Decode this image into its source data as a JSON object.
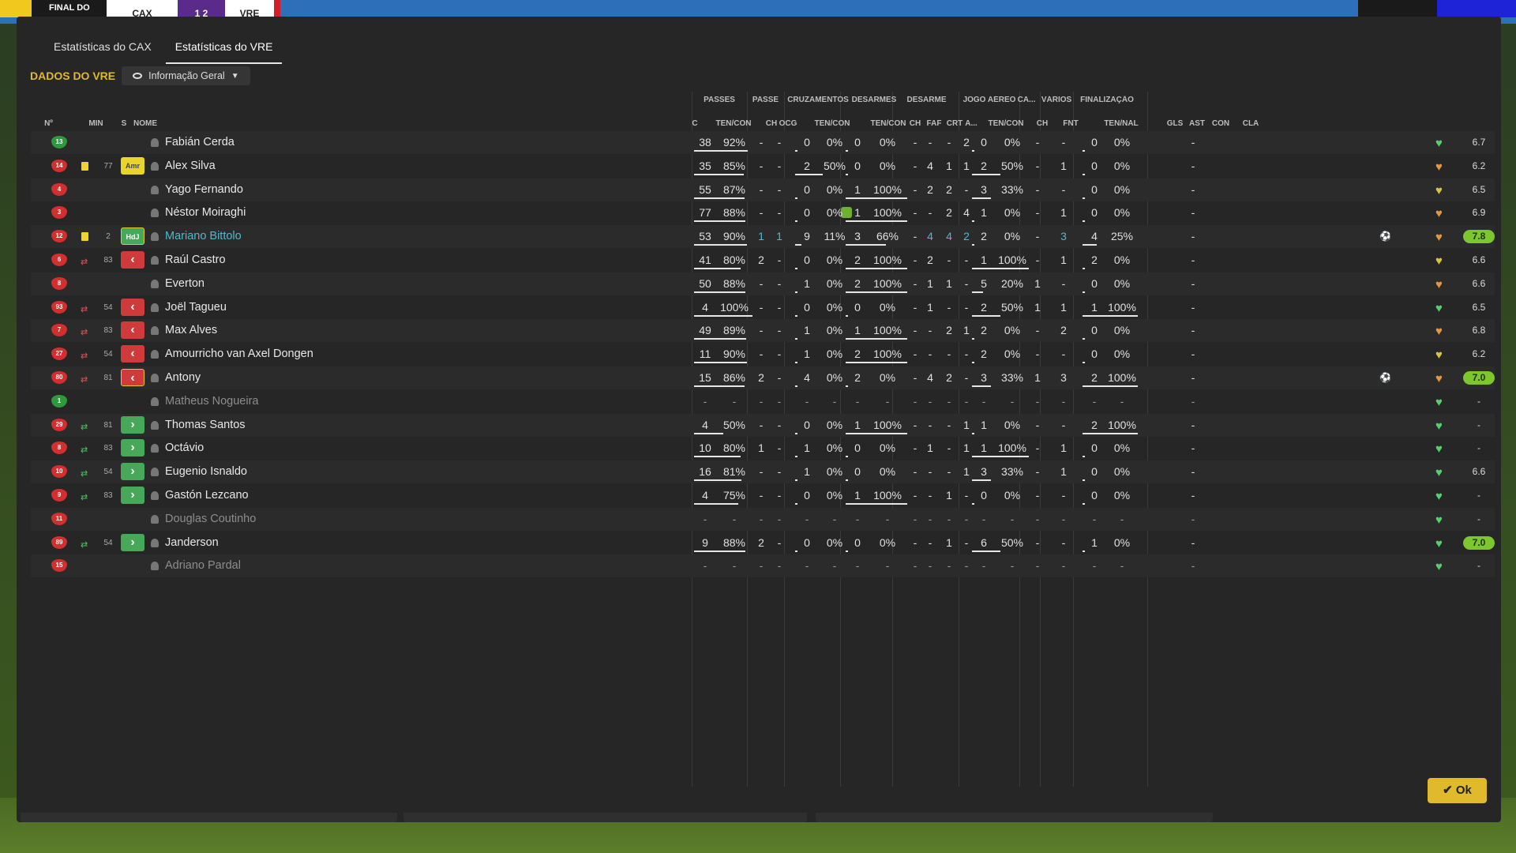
{
  "scoreboard": {
    "label": "FINAL DO",
    "home": "CAX",
    "score": "1 2",
    "away": "VRE"
  },
  "tabs": [
    {
      "label": "Estatísticas do CAX"
    },
    {
      "label": "Estatísticas do VRE"
    }
  ],
  "section_title": "DADOS DO VRE",
  "view_dropdown": "Informação Geral",
  "ok_label": "Ok",
  "group_headers": [
    "PASSES",
    "PASSE",
    "CRUZAMENTOS",
    "DESARMES",
    "DESARME",
    "JOGO AÉREO",
    "CA...",
    "VÁRIOS",
    "FINALIZAÇÃO"
  ],
  "column_headers": [
    "Nº",
    "MIN",
    "S",
    "NOME",
    "C",
    "TEN/CON",
    "CH",
    "OCG",
    "TEN/CON",
    "TEN/CON",
    "CH",
    "FAF",
    "CRT",
    "A...",
    "TEN/CON",
    "CH",
    "FNT",
    "TEN/NAL",
    "GLS",
    "AST",
    "CON",
    "CLA"
  ],
  "colors": {
    "accent": "#e1b92c",
    "highlight": "#4fb9d0",
    "best_rating": "#7cc72e"
  },
  "players": [
    {
      "no": "13",
      "kit": "g",
      "card": "",
      "minute": "",
      "status": "",
      "name": "Fabián Cerda",
      "style": "",
      "med": false,
      "pass_a": "38",
      "pass_b": "92%",
      "pch": "-",
      "ocg": "-",
      "cr_a": "0",
      "cr_b": "0%",
      "de_a": "0",
      "de_b": "0%",
      "dch": "-",
      "faf": "-",
      "crt": "-",
      "da": "2",
      "ja_a": "0",
      "ja_b": "0%",
      "cach": "-",
      "fnt": "-",
      "fi_a": "0",
      "fi_b": "0%",
      "gls": "",
      "ast": "-",
      "con": "green",
      "cla": "6.7",
      "best": false
    },
    {
      "no": "14",
      "kit": "r",
      "card": "y",
      "minute": "77",
      "status": "amr",
      "name": "Alex Silva",
      "style": "",
      "med": false,
      "pass_a": "35",
      "pass_b": "85%",
      "pch": "-",
      "ocg": "-",
      "cr_a": "2",
      "cr_b": "50%",
      "de_a": "0",
      "de_b": "0%",
      "dch": "-",
      "faf": "4",
      "crt": "1",
      "da": "1",
      "ja_a": "2",
      "ja_b": "50%",
      "cach": "-",
      "fnt": "1",
      "fi_a": "0",
      "fi_b": "0%",
      "gls": "",
      "ast": "-",
      "con": "orange",
      "cla": "6.2",
      "best": false
    },
    {
      "no": "4",
      "kit": "r",
      "card": "",
      "minute": "",
      "status": "",
      "name": "Yago Fernando",
      "style": "",
      "med": false,
      "pass_a": "55",
      "pass_b": "87%",
      "pch": "-",
      "ocg": "-",
      "cr_a": "0",
      "cr_b": "0%",
      "de_a": "1",
      "de_b": "100%",
      "dch": "-",
      "faf": "2",
      "crt": "2",
      "da": "-",
      "ja_a": "3",
      "ja_b": "33%",
      "cach": "-",
      "fnt": "-",
      "fi_a": "0",
      "fi_b": "0%",
      "gls": "",
      "ast": "-",
      "con": "yellow",
      "cla": "6.5",
      "best": false
    },
    {
      "no": "3",
      "kit": "r",
      "card": "",
      "minute": "",
      "status": "",
      "name": "Néstor Moiraghi",
      "style": "",
      "med": true,
      "pass_a": "77",
      "pass_b": "88%",
      "pch": "-",
      "ocg": "-",
      "cr_a": "0",
      "cr_b": "0%",
      "de_a": "1",
      "de_b": "100%",
      "dch": "-",
      "faf": "-",
      "crt": "2",
      "da": "4",
      "ja_a": "1",
      "ja_b": "0%",
      "cach": "-",
      "fnt": "1",
      "fi_a": "0",
      "fi_b": "0%",
      "gls": "",
      "ast": "-",
      "con": "orange",
      "cla": "6.9",
      "best": false
    },
    {
      "no": "12",
      "kit": "r",
      "card": "y",
      "minute": "2",
      "status": "hdj",
      "name": "Mariano Bittolo",
      "style": "hl",
      "med": false,
      "pass_a": "53",
      "pass_b": "90%",
      "pch": "1",
      "ocg": "1",
      "cr_a": "9",
      "cr_b": "11%",
      "de_a": "3",
      "de_b": "66%",
      "dch": "-",
      "faf": "4",
      "crt": "4",
      "da": "2",
      "ja_a": "2",
      "ja_b": "0%",
      "cach": "-",
      "fnt": "3",
      "fi_a": "4",
      "fi_b": "25%",
      "gls": "⚽",
      "ast": "-",
      "con": "orange",
      "cla": "7.8",
      "best": true
    },
    {
      "no": "6",
      "kit": "r",
      "card": "",
      "minute": "83",
      "status": "out",
      "name": "Raúl Castro",
      "style": "",
      "med": false,
      "pass_a": "41",
      "pass_b": "80%",
      "pch": "2",
      "ocg": "-",
      "cr_a": "0",
      "cr_b": "0%",
      "de_a": "2",
      "de_b": "100%",
      "dch": "-",
      "faf": "2",
      "crt": "-",
      "da": "-",
      "ja_a": "1",
      "ja_b": "100%",
      "cach": "-",
      "fnt": "1",
      "fi_a": "2",
      "fi_b": "0%",
      "gls": "",
      "ast": "-",
      "con": "yellow",
      "cla": "6.6",
      "best": false
    },
    {
      "no": "8",
      "kit": "r",
      "card": "",
      "minute": "",
      "status": "",
      "name": "Everton",
      "style": "",
      "med": false,
      "pass_a": "50",
      "pass_b": "88%",
      "pch": "-",
      "ocg": "-",
      "cr_a": "1",
      "cr_b": "0%",
      "de_a": "2",
      "de_b": "100%",
      "dch": "-",
      "faf": "1",
      "crt": "1",
      "da": "-",
      "ja_a": "5",
      "ja_b": "20%",
      "cach": "1",
      "fnt": "-",
      "fi_a": "0",
      "fi_b": "0%",
      "gls": "",
      "ast": "-",
      "con": "orange",
      "cla": "6.6",
      "best": false
    },
    {
      "no": "93",
      "kit": "r",
      "card": "",
      "minute": "54",
      "status": "out",
      "name": "Joël Tagueu",
      "style": "",
      "med": false,
      "pass_a": "4",
      "pass_b": "100%",
      "pch": "-",
      "ocg": "-",
      "cr_a": "0",
      "cr_b": "0%",
      "de_a": "0",
      "de_b": "0%",
      "dch": "-",
      "faf": "1",
      "crt": "-",
      "da": "-",
      "ja_a": "2",
      "ja_b": "50%",
      "cach": "1",
      "fnt": "1",
      "fi_a": "1",
      "fi_b": "100%",
      "gls": "",
      "ast": "-",
      "con": "green",
      "cla": "6.5",
      "best": false
    },
    {
      "no": "7",
      "kit": "r",
      "card": "",
      "minute": "83",
      "status": "out",
      "name": "Max Alves",
      "style": "",
      "med": false,
      "pass_a": "49",
      "pass_b": "89%",
      "pch": "-",
      "ocg": "-",
      "cr_a": "1",
      "cr_b": "0%",
      "de_a": "1",
      "de_b": "100%",
      "dch": "-",
      "faf": "-",
      "crt": "2",
      "da": "1",
      "ja_a": "2",
      "ja_b": "0%",
      "cach": "-",
      "fnt": "2",
      "fi_a": "0",
      "fi_b": "0%",
      "gls": "",
      "ast": "-",
      "con": "orange",
      "cla": "6.8",
      "best": false
    },
    {
      "no": "27",
      "kit": "r",
      "card": "",
      "minute": "54",
      "status": "out",
      "name": "Amourricho van Axel Dongen",
      "style": "",
      "med": false,
      "pass_a": "11",
      "pass_b": "90%",
      "pch": "-",
      "ocg": "-",
      "cr_a": "1",
      "cr_b": "0%",
      "de_a": "2",
      "de_b": "100%",
      "dch": "-",
      "faf": "-",
      "crt": "-",
      "da": "-",
      "ja_a": "2",
      "ja_b": "0%",
      "cach": "-",
      "fnt": "-",
      "fi_a": "0",
      "fi_b": "0%",
      "gls": "",
      "ast": "-",
      "con": "yellow",
      "cla": "6.2",
      "best": false
    },
    {
      "no": "80",
      "kit": "r",
      "card": "",
      "minute": "81",
      "status": "outy",
      "name": "Antony",
      "style": "",
      "med": false,
      "pass_a": "15",
      "pass_b": "86%",
      "pch": "2",
      "ocg": "-",
      "cr_a": "4",
      "cr_b": "0%",
      "de_a": "2",
      "de_b": "0%",
      "dch": "-",
      "faf": "4",
      "crt": "2",
      "da": "-",
      "ja_a": "3",
      "ja_b": "33%",
      "cach": "1",
      "fnt": "3",
      "fi_a": "2",
      "fi_b": "100%",
      "gls": "⚽",
      "ast": "-",
      "con": "orange",
      "cla": "7.0",
      "best": true
    },
    {
      "no": "1",
      "kit": "g",
      "card": "",
      "minute": "",
      "status": "",
      "name": "Matheus Nogueira",
      "style": "dim",
      "med": false,
      "pass_a": "-",
      "pass_b": "-",
      "pch": "-",
      "ocg": "-",
      "cr_a": "-",
      "cr_b": "-",
      "de_a": "-",
      "de_b": "-",
      "dch": "-",
      "faf": "-",
      "crt": "-",
      "da": "-",
      "ja_a": "-",
      "ja_b": "-",
      "cach": "-",
      "fnt": "-",
      "fi_a": "-",
      "fi_b": "-",
      "gls": "",
      "ast": "-",
      "con": "green",
      "cla": "-",
      "best": false
    },
    {
      "no": "29",
      "kit": "r",
      "card": "",
      "minute": "81",
      "status": "in",
      "name": "Thomas Santos",
      "style": "",
      "med": false,
      "pass_a": "4",
      "pass_b": "50%",
      "pch": "-",
      "ocg": "-",
      "cr_a": "0",
      "cr_b": "0%",
      "de_a": "1",
      "de_b": "100%",
      "dch": "-",
      "faf": "-",
      "crt": "-",
      "da": "1",
      "ja_a": "1",
      "ja_b": "0%",
      "cach": "-",
      "fnt": "-",
      "fi_a": "2",
      "fi_b": "100%",
      "gls": "",
      "ast": "-",
      "con": "green",
      "cla": "-",
      "best": false
    },
    {
      "no": "8",
      "kit": "r",
      "card": "",
      "minute": "83",
      "status": "in",
      "name": "Octávio",
      "style": "",
      "med": false,
      "pass_a": "10",
      "pass_b": "80%",
      "pch": "1",
      "ocg": "-",
      "cr_a": "1",
      "cr_b": "0%",
      "de_a": "0",
      "de_b": "0%",
      "dch": "-",
      "faf": "1",
      "crt": "-",
      "da": "1",
      "ja_a": "1",
      "ja_b": "100%",
      "cach": "-",
      "fnt": "1",
      "fi_a": "0",
      "fi_b": "0%",
      "gls": "",
      "ast": "-",
      "con": "green",
      "cla": "-",
      "best": false
    },
    {
      "no": "10",
      "kit": "r",
      "card": "",
      "minute": "54",
      "status": "in",
      "name": "Eugenio Isnaldo",
      "style": "",
      "med": false,
      "pass_a": "16",
      "pass_b": "81%",
      "pch": "-",
      "ocg": "-",
      "cr_a": "1",
      "cr_b": "0%",
      "de_a": "0",
      "de_b": "0%",
      "dch": "-",
      "faf": "-",
      "crt": "-",
      "da": "1",
      "ja_a": "3",
      "ja_b": "33%",
      "cach": "-",
      "fnt": "1",
      "fi_a": "0",
      "fi_b": "0%",
      "gls": "",
      "ast": "-",
      "con": "green",
      "cla": "6.6",
      "best": false
    },
    {
      "no": "9",
      "kit": "r",
      "card": "",
      "minute": "83",
      "status": "in",
      "name": "Gastón Lezcano",
      "style": "",
      "med": false,
      "pass_a": "4",
      "pass_b": "75%",
      "pch": "-",
      "ocg": "-",
      "cr_a": "0",
      "cr_b": "0%",
      "de_a": "1",
      "de_b": "100%",
      "dch": "-",
      "faf": "-",
      "crt": "1",
      "da": "-",
      "ja_a": "0",
      "ja_b": "0%",
      "cach": "-",
      "fnt": "-",
      "fi_a": "0",
      "fi_b": "0%",
      "gls": "",
      "ast": "-",
      "con": "green",
      "cla": "-",
      "best": false
    },
    {
      "no": "11",
      "kit": "r",
      "card": "",
      "minute": "",
      "status": "",
      "name": "Douglas Coutinho",
      "style": "dim",
      "med": false,
      "pass_a": "-",
      "pass_b": "-",
      "pch": "-",
      "ocg": "-",
      "cr_a": "-",
      "cr_b": "-",
      "de_a": "-",
      "de_b": "-",
      "dch": "-",
      "faf": "-",
      "crt": "-",
      "da": "-",
      "ja_a": "-",
      "ja_b": "-",
      "cach": "-",
      "fnt": "-",
      "fi_a": "-",
      "fi_b": "-",
      "gls": "",
      "ast": "-",
      "con": "green",
      "cla": "-",
      "best": false
    },
    {
      "no": "89",
      "kit": "r",
      "card": "",
      "minute": "54",
      "status": "in",
      "name": "Janderson",
      "style": "",
      "med": false,
      "pass_a": "9",
      "pass_b": "88%",
      "pch": "2",
      "ocg": "-",
      "cr_a": "0",
      "cr_b": "0%",
      "de_a": "0",
      "de_b": "0%",
      "dch": "-",
      "faf": "-",
      "crt": "1",
      "da": "-",
      "ja_a": "6",
      "ja_b": "50%",
      "cach": "-",
      "fnt": "-",
      "fi_a": "1",
      "fi_b": "0%",
      "gls": "",
      "ast": "-",
      "con": "green",
      "cla": "7.0",
      "best": true
    },
    {
      "no": "15",
      "kit": "r",
      "card": "",
      "minute": "",
      "status": "",
      "name": "Adriano Pardal",
      "style": "dim",
      "med": false,
      "pass_a": "-",
      "pass_b": "-",
      "pch": "-",
      "ocg": "-",
      "cr_a": "-",
      "cr_b": "-",
      "de_a": "-",
      "de_b": "-",
      "dch": "-",
      "faf": "-",
      "crt": "-",
      "da": "-",
      "ja_a": "-",
      "ja_b": "-",
      "cach": "-",
      "fnt": "-",
      "fi_a": "-",
      "fi_b": "-",
      "gls": "",
      "ast": "-",
      "con": "green",
      "cla": "-",
      "best": false
    }
  ]
}
